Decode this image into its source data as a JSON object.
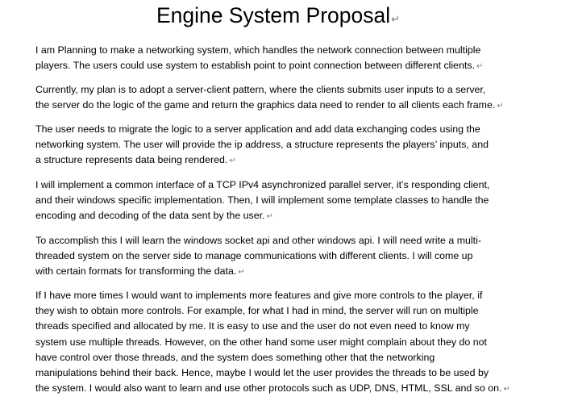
{
  "document": {
    "title": "Engine System Proposal",
    "paragraph_mark": "↵",
    "paragraphs": [
      {
        "lines": [
          "I am Planning to make a networking system, which handles the network connection between multiple",
          "players. The users could use system to establish point to point connection between different clients."
        ]
      },
      {
        "lines": [
          "Currently, my plan is to adopt a server-client pattern, where the clients submits user inputs to a server,",
          "the server do the logic of the game and return the graphics data need to render to all clients each frame."
        ]
      },
      {
        "lines": [
          "The user needs to migrate the logic to a server application and add data exchanging codes using the",
          "networking system. The user will provide the ip address, a structure represents the players’ inputs, and",
          "a structure represents data being rendered."
        ]
      },
      {
        "lines": [
          "I will implement a common interface of a TCP IPv4 asynchronized parallel server, it’s responding client,",
          "and their windows specific implementation.  Then, I will implement some template classes to handle the",
          "encoding and decoding of the data sent by the user."
        ]
      },
      {
        "lines": [
          "To accomplish this I will learn the windows socket api and other windows api. I will need write a multi-",
          "threaded system on the server side to manage communications with different clients. I will come up",
          "with certain formats for transforming the data."
        ]
      },
      {
        "lines": [
          "If I have more times I would want to implements more features and give more controls to the player, if",
          "they wish to obtain more controls. For example, for what I had in mind, the server will run on multiple",
          "threads specified and allocated by me. It is easy to use and the user do not even need to know my",
          "system use multiple threads. However, on the other hand some user might complain about they do not",
          "have control over those threads, and the system does something other that the networking",
          "manipulations behind their back. Hence, maybe I would let the user provides the threads to be used by",
          "the system. I would also want to learn and use other protocols such as UDP, DNS, HTML, SSL and so on."
        ]
      }
    ]
  }
}
